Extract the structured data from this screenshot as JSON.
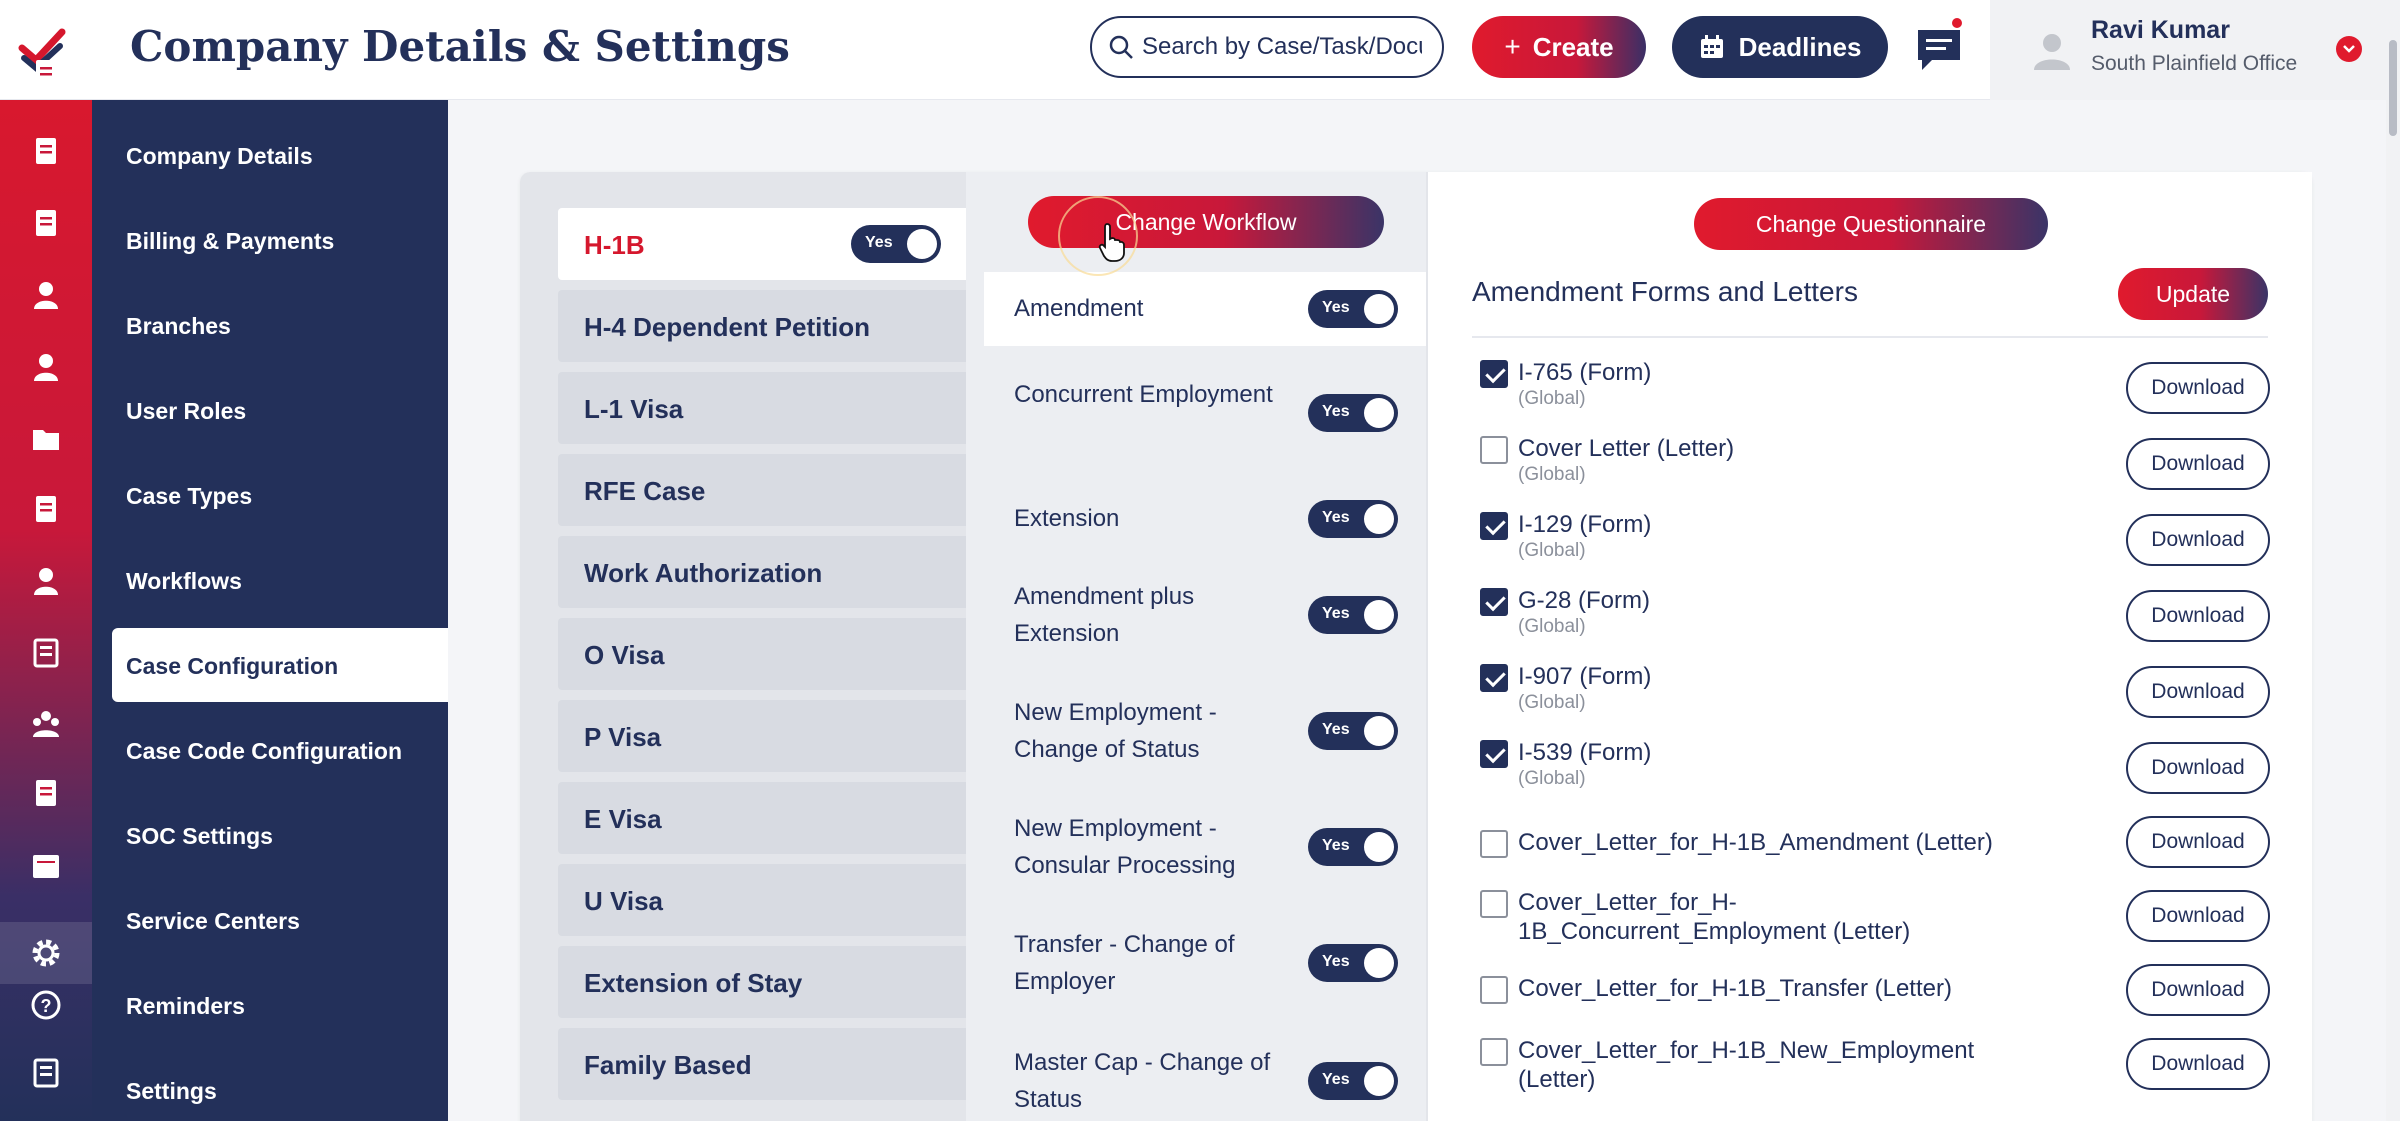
{
  "header": {
    "title": "Company Details & Settings",
    "search_placeholder": "Search by Case/Task/Document",
    "create_label": "Create",
    "deadlines_label": "Deadlines"
  },
  "user": {
    "name": "Ravi Kumar",
    "office": "South Plainfield Office"
  },
  "sidebar": {
    "items": [
      {
        "label": "Company Details"
      },
      {
        "label": "Billing & Payments"
      },
      {
        "label": "Branches"
      },
      {
        "label": "User Roles"
      },
      {
        "label": "Case Types"
      },
      {
        "label": "Workflows"
      },
      {
        "label": "Case Configuration",
        "active": true
      },
      {
        "label": "Case Code Configuration"
      },
      {
        "label": "SOC Settings"
      },
      {
        "label": "Service Centers"
      },
      {
        "label": "Reminders"
      },
      {
        "label": "Settings"
      }
    ]
  },
  "rail_icons": [
    "edit-icon",
    "documents-icon",
    "clipboard-icon",
    "person-icon",
    "contacts-icon",
    "folder-icon",
    "notes-icon",
    "employee-icon",
    "book-icon",
    "team-icon",
    "forms-icon",
    "calendar-icon",
    "gear-icon",
    "help-icon",
    "id-card-icon"
  ],
  "case_types": {
    "active_toggle_label": "Yes",
    "items": [
      {
        "label": "H-1B",
        "active": true
      },
      {
        "label": "H-4 Dependent Petition"
      },
      {
        "label": "L-1 Visa"
      },
      {
        "label": "RFE Case"
      },
      {
        "label": "Work Authorization"
      },
      {
        "label": "O Visa"
      },
      {
        "label": "P Visa"
      },
      {
        "label": "E Visa"
      },
      {
        "label": "U Visa"
      },
      {
        "label": "Extension of Stay"
      },
      {
        "label": "Family Based"
      }
    ]
  },
  "workflows": {
    "change_label": "Change Workflow",
    "toggle_label": "Yes",
    "items": [
      {
        "label": "Amendment",
        "active": true
      },
      {
        "label": "Concurrent Employment"
      },
      {
        "label": "Extension"
      },
      {
        "label": "Amendment plus Extension"
      },
      {
        "label": "New Employment - Change of Status"
      },
      {
        "label": "New Employment - Consular Processing"
      },
      {
        "label": "Transfer - Change of Employer"
      },
      {
        "label": "Master Cap - Change of Status"
      }
    ]
  },
  "forms": {
    "change_questionnaire_label": "Change Questionnaire",
    "title": "Amendment Forms and Letters",
    "update_label": "Update",
    "download_label": "Download",
    "items": [
      {
        "name": "I-765 (Form)",
        "scope": "(Global)",
        "checked": true
      },
      {
        "name": "Cover Letter (Letter)",
        "scope": "(Global)",
        "checked": false
      },
      {
        "name": "I-129 (Form)",
        "scope": "(Global)",
        "checked": true
      },
      {
        "name": "G-28 (Form)",
        "scope": "(Global)",
        "checked": true
      },
      {
        "name": "I-907 (Form)",
        "scope": "(Global)",
        "checked": true
      },
      {
        "name": "I-539 (Form)",
        "scope": "(Global)",
        "checked": true
      },
      {
        "name": "Cover_Letter_for_H-1B_Amendment (Letter)",
        "checked": false
      },
      {
        "name": "Cover_Letter_for_H-1B_Concurrent_Employment (Letter)",
        "checked": false
      },
      {
        "name": "Cover_Letter_for_H-1B_Transfer (Letter)",
        "checked": false
      },
      {
        "name": "Cover_Letter_for_H-1B_New_Employment (Letter)",
        "checked": false
      }
    ]
  },
  "colors": {
    "brand_red": "#d5172d",
    "navy": "#23305a"
  }
}
